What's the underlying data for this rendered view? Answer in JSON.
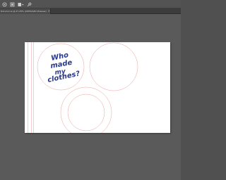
{
  "toolbar": {
    "tools": [
      {
        "name": "home-icon"
      },
      {
        "name": "artboard-icon"
      },
      {
        "name": "options-icon"
      },
      {
        "name": "pin-icon"
      }
    ]
  },
  "document": {
    "tab_label": "Dot-mini.ai @ 27.25% (CMYK/GPU Preview)",
    "close_glyph": "×"
  },
  "artwork": {
    "logo_text": "Who made my clothes?",
    "logo_color": "#2b3a8c",
    "guide_color": "#e89a9a"
  }
}
